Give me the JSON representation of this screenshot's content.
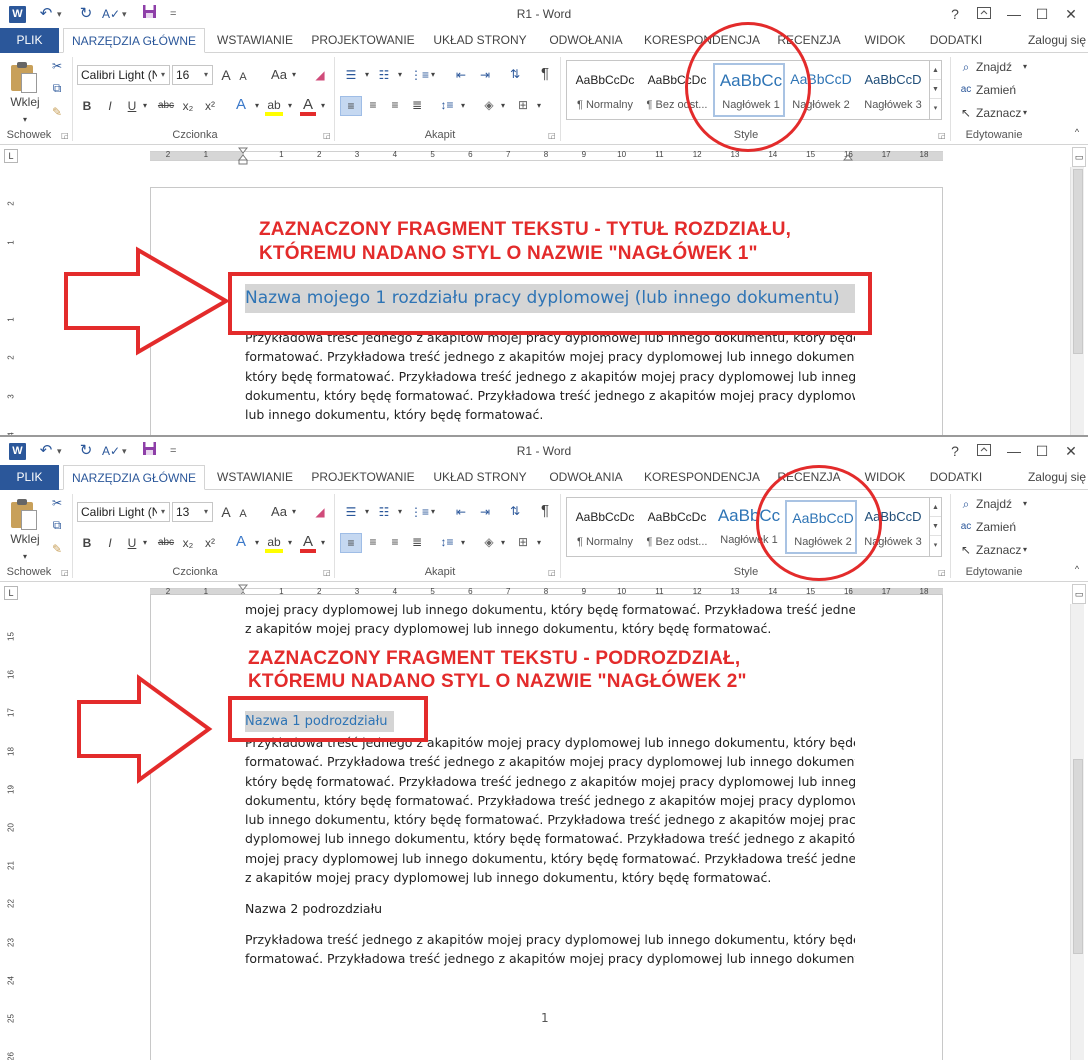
{
  "window": {
    "title": "R1 - Word",
    "app_icon": "W",
    "help": "?",
    "restore_icon": "ribbon-display-options",
    "minimize": "—",
    "maximize": "☐",
    "close": "✕"
  },
  "quick_access": {
    "undo": "↶",
    "redo": "↻",
    "spelling": "A✓",
    "save_icon": "save-disk",
    "customize": "="
  },
  "tabs": {
    "file": "PLIK",
    "home": "NARZĘDZIA GŁÓWNE",
    "insert": "WSTAWIANIE",
    "design": "PROJEKTOWANIE",
    "layout": "UKŁAD STRONY",
    "references": "ODWOŁANIA",
    "mailings": "KORESPONDENCJA",
    "review": "RECENZJA",
    "view": "WIDOK",
    "addins": "DODATKI",
    "sign_in": "Zaloguj się"
  },
  "ribbon": {
    "clipboard": {
      "label": "Schowek",
      "paste": "Wklej"
    },
    "font": {
      "label": "Czcionka",
      "font_name": "Calibri Light (N",
      "grow": "A",
      "shrink": "A",
      "case": "Aa",
      "bold": "B",
      "italic": "I",
      "underline": "U",
      "strike": "abc",
      "subscript": "x₂",
      "superscript": "x²"
    },
    "paragraph": {
      "label": "Akapit",
      "pilcrow": "¶"
    },
    "styles": {
      "label": "Style",
      "items": [
        {
          "sample": "AaBbCcDc",
          "name": "¶ Normalny"
        },
        {
          "sample": "AaBbCcDc",
          "name": "¶ Bez odst..."
        },
        {
          "sample": "AaBbCc",
          "name": "Nagłówek 1"
        },
        {
          "sample": "AaBbCcD",
          "name": "Nagłówek 2"
        },
        {
          "sample": "AaBbCcD",
          "name": "Nagłówek 3"
        }
      ]
    },
    "editing": {
      "label": "Edytowanie",
      "find": "Znajdź",
      "replace": "Zamień",
      "select": "Zaznacz"
    }
  },
  "ruler": {
    "corner": "L",
    "numbers": [
      "2",
      "1",
      "",
      "1",
      "2",
      "3",
      "4",
      "5",
      "6",
      "7",
      "8",
      "9",
      "10",
      "11",
      "12",
      "13",
      "14",
      "15",
      "16",
      "17",
      "18"
    ]
  },
  "panel1": {
    "font_size": "16",
    "vruler_numbers": [
      "2",
      "1",
      "",
      "1",
      "2",
      "3",
      "4"
    ],
    "annotation": [
      "ZAZNACZONY FRAGMENT TEKSTU - TYTUŁ ROZDZIAŁU,",
      "KTÓREMU NADANO STYL O NAZWIE \"NAGŁÓWEK 1\""
    ],
    "heading": "Nazwa mojego 1 rozdziału pracy dyplomowej (lub innego dokumentu)",
    "body_lines": [
      "Przykładowa treść jednego z akapitów mojej pracy dyplomowej lub innego dokumentu, który będę",
      "formatować. Przykładowa treść jednego z akapitów mojej pracy dyplomowej lub innego dokumentu,",
      "który będę formatować. Przykładowa treść jednego z akapitów mojej pracy dyplomowej lub innego",
      "dokumentu, który będę formatować. Przykładowa treść jednego z akapitów mojej pracy dyplomowej",
      "lub innego dokumentu, który będę formatować."
    ]
  },
  "panel2": {
    "font_size": "13",
    "vruler_numbers": [
      "15",
      "16",
      "17",
      "18",
      "19",
      "20",
      "21",
      "22",
      "23",
      "24",
      "25",
      "26"
    ],
    "top_lines": [
      "mojej pracy dyplomowej lub innego dokumentu, który będę formatować. Przykładowa treść jednego",
      "z akapitów mojej pracy dyplomowej lub innego dokumentu, który będę formatować."
    ],
    "annotation": [
      "ZAZNACZONY FRAGMENT TEKSTU - PODROZDZIAŁ,",
      "KTÓREMU NADANO STYL O NAZWIE \"NAGŁÓWEK 2\""
    ],
    "heading": "Nazwa 1 podrozdziału",
    "body_lines": [
      "Przykładowa treść jednego z akapitów mojej pracy dyplomowej lub innego dokumentu, który będę",
      "formatować. Przykładowa treść jednego z akapitów mojej pracy dyplomowej lub innego dokumentu,",
      "który będę formatować. Przykładowa treść jednego z akapitów mojej pracy dyplomowej lub innego",
      "dokumentu, który będę formatować. Przykładowa treść jednego z akapitów mojej pracy dyplomowej",
      "lub innego dokumentu, który będę formatować. Przykładowa treść jednego z akapitów mojej pracy",
      "dyplomowej lub innego dokumentu, który będę formatować. Przykładowa treść jednego z akapitów",
      "mojej pracy dyplomowej lub innego dokumentu, który będę formatować. Przykładowa treść jednego",
      "z akapitów mojej pracy dyplomowej lub innego dokumentu, który będę formatować."
    ],
    "heading2_plain": "Nazwa 2 podrozdziału",
    "last_lines": [
      "Przykładowa treść jednego z akapitów mojej pracy dyplomowej lub innego dokumentu, który będę",
      "formatować. Przykładowa treść jednego z akapitów mojej pracy dyplomowej lub innego dokumentu,"
    ],
    "page_number": "1"
  },
  "colors": {
    "accent": "#2b579a",
    "heading": "#2e74b5",
    "annotation_red": "#e32b2b",
    "selection": "#d5d5d5"
  }
}
